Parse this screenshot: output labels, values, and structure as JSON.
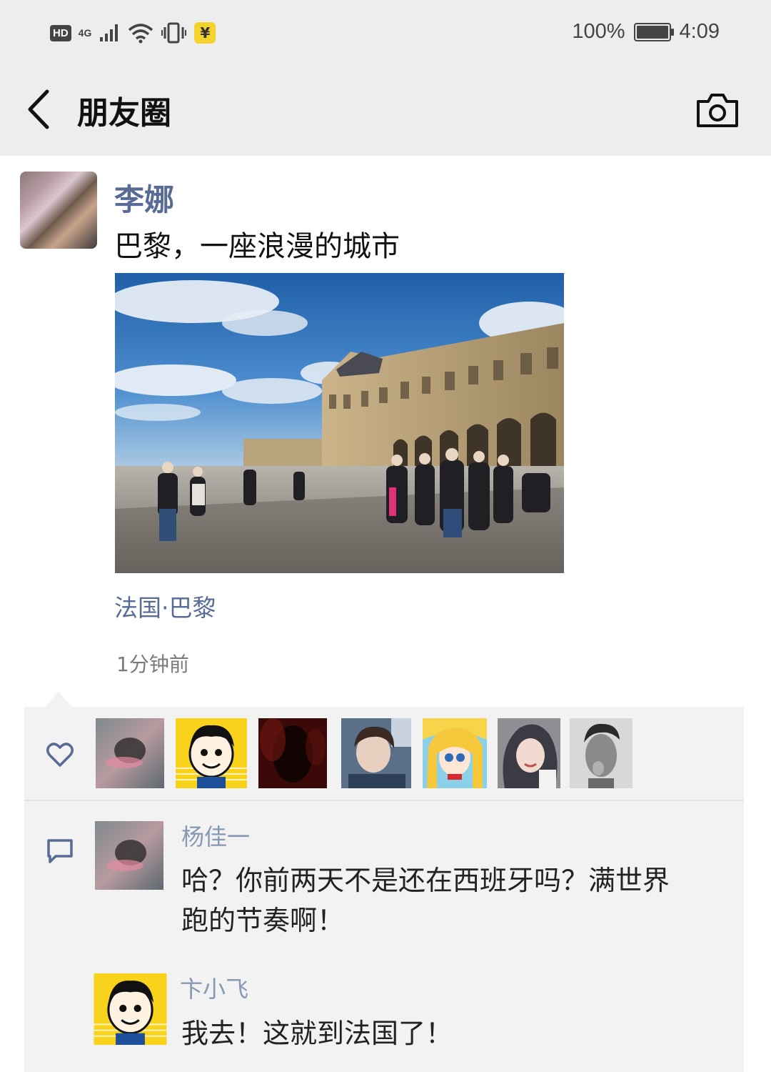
{
  "status_bar": {
    "hd": "HD",
    "network": "4G",
    "battery_percent": "100%",
    "battery_level": 1.0,
    "time": "4:09",
    "yen_icon": "¥"
  },
  "nav": {
    "title": "朋友圈"
  },
  "post": {
    "author": "李娜",
    "text": "巴黎，一座浪漫的城市",
    "location": "法国·巴黎",
    "time": "1分钟前"
  },
  "likes": {
    "icon": "heart-icon",
    "count": 7
  },
  "comments": [
    {
      "name": "杨佳一",
      "text_line1": "哈？你前两天不是还在西班牙吗？满世界",
      "text_line2": "跑的节奏啊！"
    },
    {
      "name": "卞小飞",
      "text_line1": "我去！这就到法国了！"
    }
  ],
  "colors": {
    "name_link": "#576b95",
    "comment_name": "#8798b5",
    "panel_bg": "#f2f2f2",
    "header_bg": "#ededed"
  }
}
